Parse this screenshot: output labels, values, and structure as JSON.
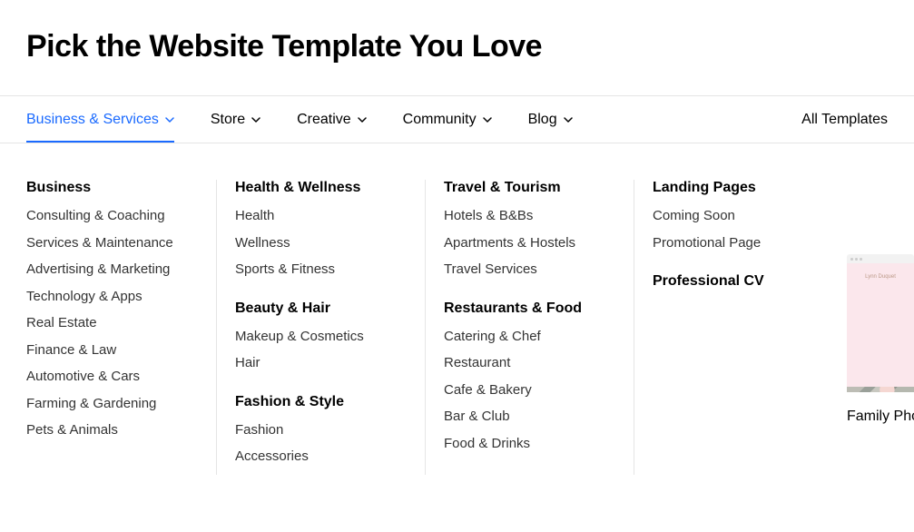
{
  "page_title": "Pick the Website Template You Love",
  "nav": {
    "items": [
      {
        "label": "Business & Services",
        "active": true
      },
      {
        "label": "Store",
        "active": false
      },
      {
        "label": "Creative",
        "active": false
      },
      {
        "label": "Community",
        "active": false
      },
      {
        "label": "Blog",
        "active": false
      }
    ],
    "all_templates": "All Templates"
  },
  "mega": {
    "col1": {
      "group1": {
        "head": "Business",
        "items": [
          "Consulting & Coaching",
          "Services & Maintenance",
          "Advertising & Marketing",
          "Technology & Apps",
          "Real Estate",
          "Finance & Law",
          "Automotive & Cars",
          "Farming & Gardening",
          "Pets & Animals"
        ]
      }
    },
    "col2": {
      "group1": {
        "head": "Health & Wellness",
        "items": [
          "Health",
          "Wellness",
          "Sports & Fitness"
        ]
      },
      "group2": {
        "head": "Beauty & Hair",
        "items": [
          "Makeup & Cosmetics",
          "Hair"
        ]
      },
      "group3": {
        "head": "Fashion & Style",
        "items": [
          "Fashion",
          "Accessories"
        ]
      }
    },
    "col3": {
      "group1": {
        "head": "Travel & Tourism",
        "items": [
          "Hotels & B&Bs",
          "Apartments & Hostels",
          "Travel Services"
        ]
      },
      "group2": {
        "head": "Restaurants & Food",
        "items": [
          "Catering & Chef",
          "Restaurant",
          "Cafe & Bakery",
          "Bar & Club",
          "Food & Drinks"
        ]
      }
    },
    "col4": {
      "group1": {
        "head": "Landing Pages",
        "items": [
          "Coming Soon",
          "Promotional Page"
        ]
      },
      "group2": {
        "head": "Professional CV",
        "items": []
      }
    }
  },
  "template_peek": {
    "small_text": "Lynn Duquet",
    "caption": "Family Pho"
  }
}
